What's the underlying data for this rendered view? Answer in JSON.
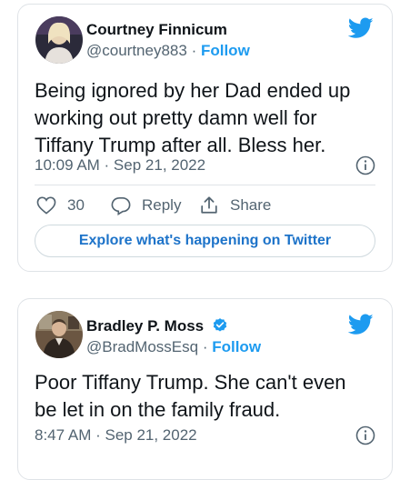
{
  "tweets": [
    {
      "name": "Courtney Finnicum",
      "handle": "@courtney883",
      "separator": "·",
      "follow": "Follow",
      "text": "Being ignored by her Dad ended up working out pretty damn well for Tiffany Trump after all. Bless her.",
      "time": "10:09 AM · Sep 21, 2022",
      "likes": "30",
      "reply": "Reply",
      "share": "Share",
      "explore": "Explore what's happening on Twitter",
      "verified": false
    },
    {
      "name": "Bradley P. Moss",
      "handle": "@BradMossEsq",
      "separator": "·",
      "follow": "Follow",
      "text": "Poor Tiffany Trump. She can't even be let in on the family fraud.",
      "time": "8:47 AM · Sep 21, 2022",
      "verified": true
    }
  ],
  "colors": {
    "twitter_blue": "#1d9bf0",
    "link_blue": "#1d73c9",
    "muted": "#536471"
  },
  "icons": [
    "twitter-bird-icon",
    "info-icon",
    "heart-icon",
    "reply-icon",
    "share-icon",
    "verified-icon"
  ]
}
